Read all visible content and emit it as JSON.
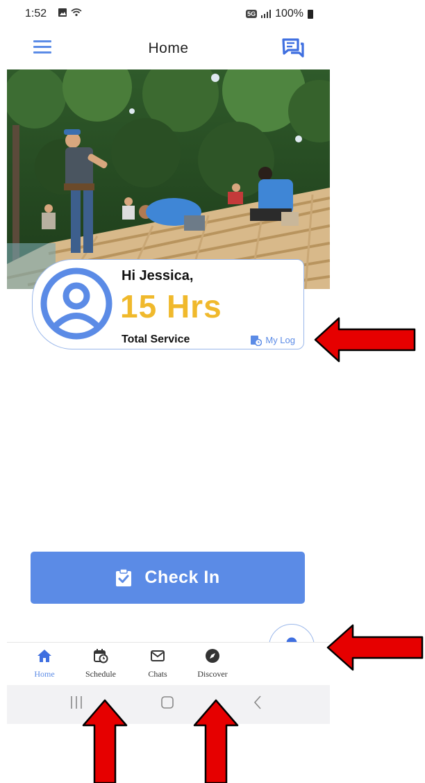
{
  "status_bar": {
    "time": "1:52",
    "battery": "100%",
    "network_badge": "5G"
  },
  "header": {
    "title": "Home"
  },
  "service_card": {
    "greeting": "Hi Jessica,",
    "hours": "15 Hrs",
    "total_label": "Total Service",
    "log_label": "My Log"
  },
  "checkin": {
    "label": "Check In"
  },
  "bottom_nav": {
    "items": [
      {
        "label": "Home",
        "icon": "home-icon",
        "active": true
      },
      {
        "label": "Schedule",
        "icon": "calendar-clock-icon",
        "active": false
      },
      {
        "label": "Chats",
        "icon": "envelope-icon",
        "active": false
      },
      {
        "label": "Discover",
        "icon": "compass-icon",
        "active": false
      }
    ]
  },
  "colors": {
    "accent": "#5b8be6",
    "hours": "#f0b92c",
    "arrow": "#e60000"
  }
}
